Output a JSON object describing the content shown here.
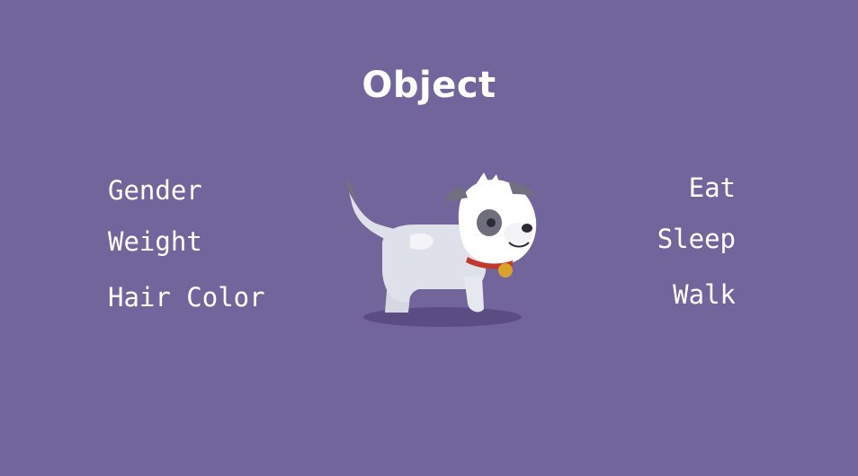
{
  "slide": {
    "title": "Object",
    "properties": [
      "Gender",
      "Weight",
      "Hair Color"
    ],
    "methods": [
      "Eat",
      "Sleep",
      "Walk"
    ],
    "illustration": "dog-illustration",
    "background_color": "#72659b"
  }
}
